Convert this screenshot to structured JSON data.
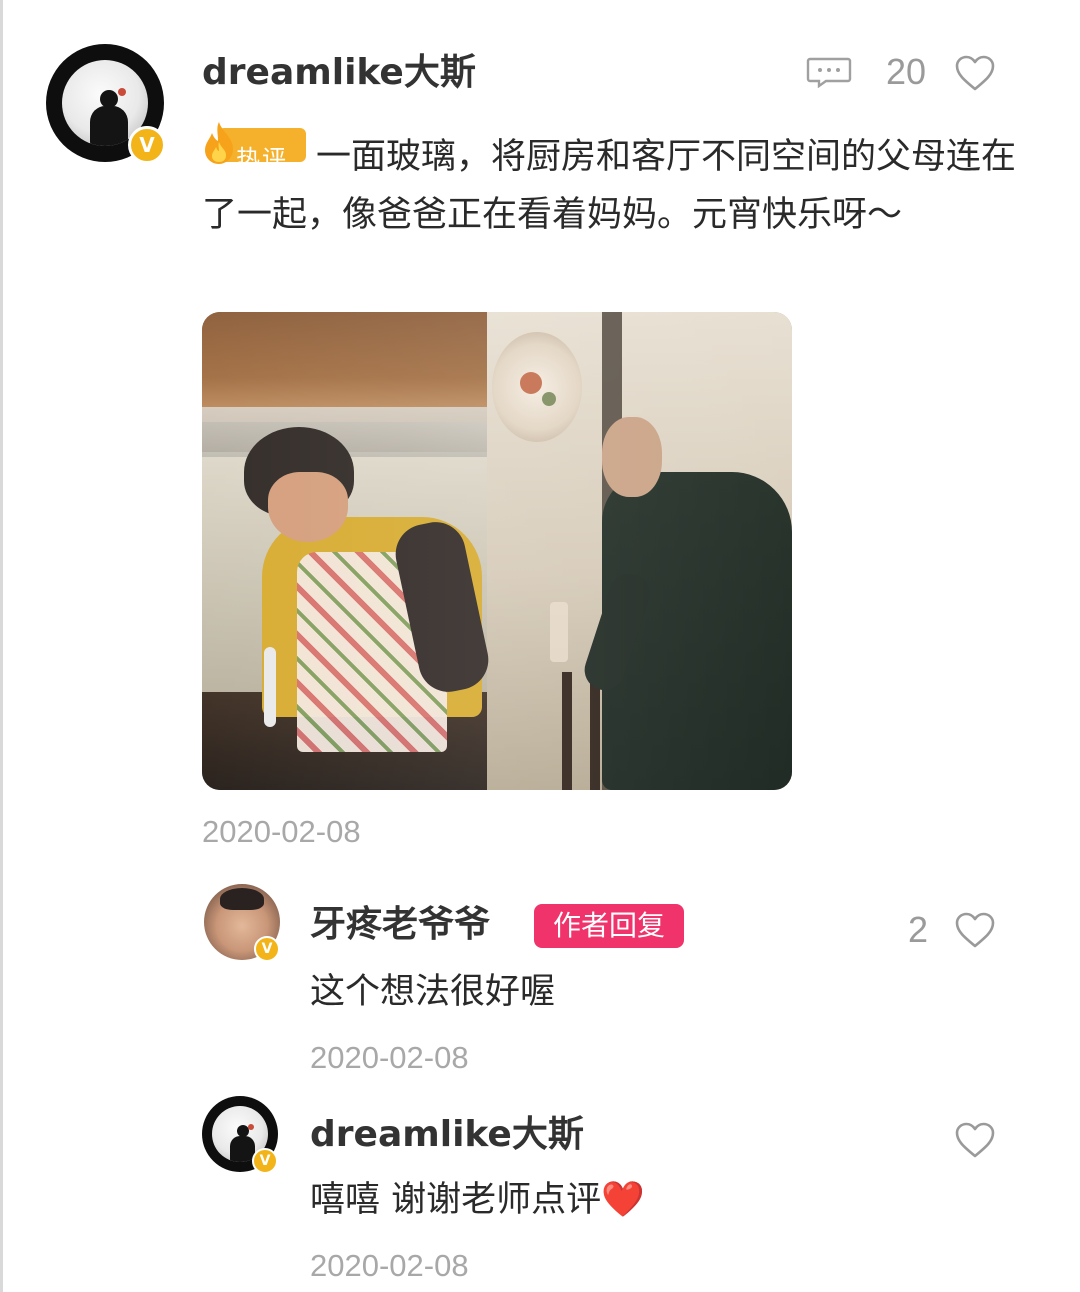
{
  "main_comment": {
    "username": "dreamlike大斯",
    "hot_tag": "热评",
    "text": "一面玻璃，将厨房和客厅不同空间的父母连在了一起，像爸爸正在看着妈妈。元宵快乐呀～",
    "date": "2020-02-08",
    "like_count": "20",
    "verified_badge": "V"
  },
  "replies": [
    {
      "username": "牙疼老爷爷",
      "author_tag": "作者回复",
      "text": "这个想法很好喔",
      "date": "2020-02-08",
      "like_count": "2",
      "verified_badge": "V"
    },
    {
      "username": "dreamlike大斯",
      "text": "嘻嘻 谢谢老师点评❤️",
      "date": "2020-02-08",
      "like_count": "",
      "verified_badge": "V"
    }
  ],
  "colors": {
    "hot_tag": "#f5b12b",
    "author_tag": "#f0336a",
    "verified": "#f2b418",
    "muted": "#a8a8a8"
  },
  "icons": [
    "more-comment-icon",
    "heart-icon",
    "flame-icon",
    "verified-icon"
  ]
}
